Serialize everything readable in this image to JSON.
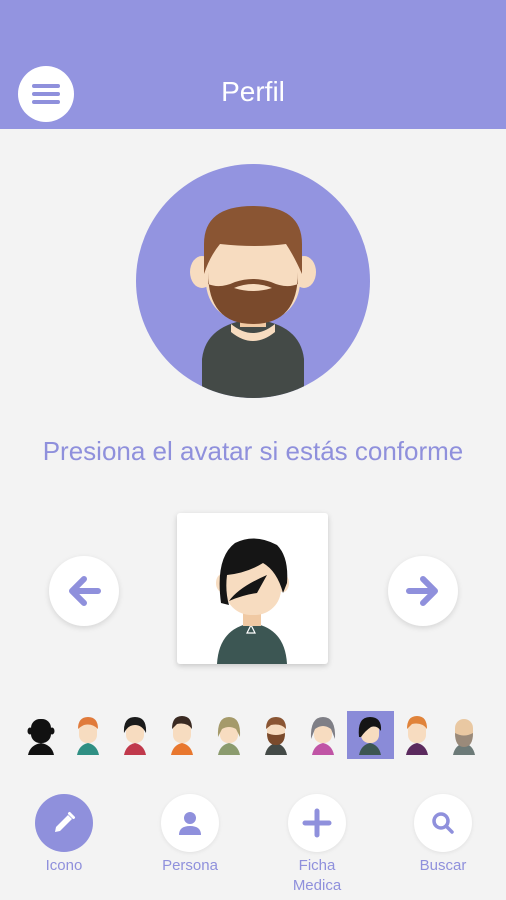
{
  "header": {
    "title": "Perfil",
    "menu_icon": "hamburger-menu-icon",
    "background": "#9394e0"
  },
  "current_avatar": {
    "icon": "bearded-man-avatar"
  },
  "prompt_text": "Presiona el avatar si estás conforme",
  "preview": {
    "icon": "black-hair-avatar"
  },
  "navigation_arrows": {
    "left_icon": "arrow-left-icon",
    "right_icon": "arrow-right-icon"
  },
  "avatar_strip": [
    {
      "name": "silhouette-black"
    },
    {
      "name": "ginger-boy"
    },
    {
      "name": "black-hair-girl"
    },
    {
      "name": "dark-hair-boy"
    },
    {
      "name": "olive-hair-girl"
    },
    {
      "name": "bearded-man"
    },
    {
      "name": "gray-hair-girl"
    },
    {
      "name": "black-hair-emo",
      "selected": true
    },
    {
      "name": "ginger-man"
    },
    {
      "name": "bald-bearded-man"
    }
  ],
  "bottom_nav": [
    {
      "label": "Icono",
      "icon": "pencil-icon",
      "active": true
    },
    {
      "label": "Persona",
      "icon": "person-icon",
      "active": false
    },
    {
      "label": "Ficha\nMedica",
      "icon": "plus-icon",
      "active": false
    },
    {
      "label": "Buscar",
      "icon": "search-icon",
      "active": false
    }
  ],
  "colors": {
    "accent": "#9394e0",
    "text_accent": "#8f90dc",
    "background": "#f3f3f3"
  }
}
